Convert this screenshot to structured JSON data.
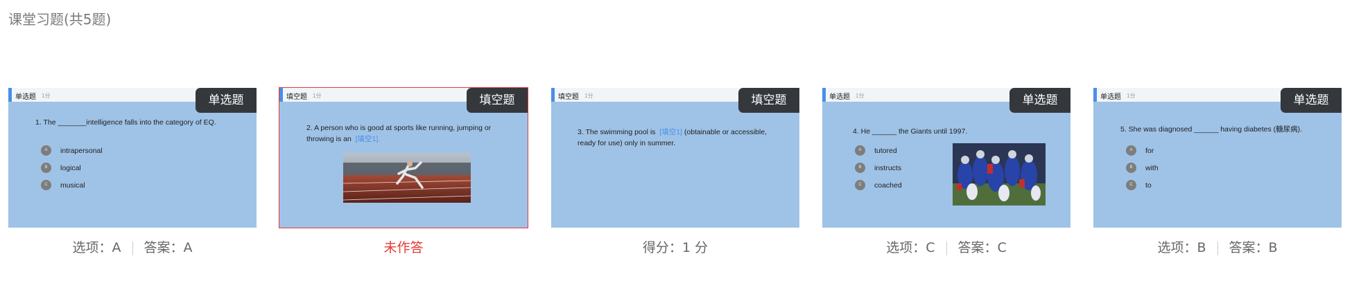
{
  "title": "课堂习题(共5题)",
  "cards": [
    {
      "type_small": "单选题",
      "score_small": "1分",
      "badge": "单选题",
      "question": "1. The _______intelligence falls into the category of EQ.",
      "options": [
        {
          "letter": "A",
          "text": "intrapersonal"
        },
        {
          "letter": "B",
          "text": "logical"
        },
        {
          "letter": "C",
          "text": "musical"
        }
      ],
      "status": {
        "choice_label": "选项：A",
        "answer_label": "答案：A"
      }
    },
    {
      "type_small": "填空题",
      "score_small": "1分",
      "badge": "填空题",
      "question_line1": "2. A person who is good at sports like running, jumping or",
      "question_line2": "throwing is an",
      "blank": "[填空1]",
      "blank_end": ".",
      "image_alt": "sprinter-photo",
      "status": {
        "text": "未作答"
      }
    },
    {
      "type_small": "填空题",
      "score_small": "1分",
      "badge": "填空题",
      "question_line1_a": "3. The swimming pool is",
      "blank": "[填空1]",
      "question_line1_b": "(obtainable or accessible,",
      "question_line2": "ready for use) only in summer.",
      "status": {
        "text": "得分：1 分"
      }
    },
    {
      "type_small": "单选题",
      "score_small": "1分",
      "badge": "单选题",
      "question": "4. He ______ the Giants until 1997.",
      "options": [
        {
          "letter": "A",
          "text": "tutored"
        },
        {
          "letter": "B",
          "text": "instructs"
        },
        {
          "letter": "C",
          "text": "coached"
        }
      ],
      "image_alt": "football-team-photo",
      "status": {
        "choice_label": "选项：C",
        "answer_label": "答案：C"
      }
    },
    {
      "type_small": "单选题",
      "score_small": "1分",
      "badge": "单选题",
      "question": "5. She was diagnosed ______ having diabetes (糖尿病).",
      "options": [
        {
          "letter": "A",
          "text": "for"
        },
        {
          "letter": "B",
          "text": "with"
        },
        {
          "letter": "C",
          "text": "to"
        }
      ],
      "status": {
        "choice_label": "选项：B",
        "answer_label": "答案：B"
      }
    }
  ],
  "colors": {
    "card_bg": "#9fc3e7",
    "badge_bg": "#34383d",
    "accent": "#4a8ee8",
    "unanswered": "#e53935"
  }
}
